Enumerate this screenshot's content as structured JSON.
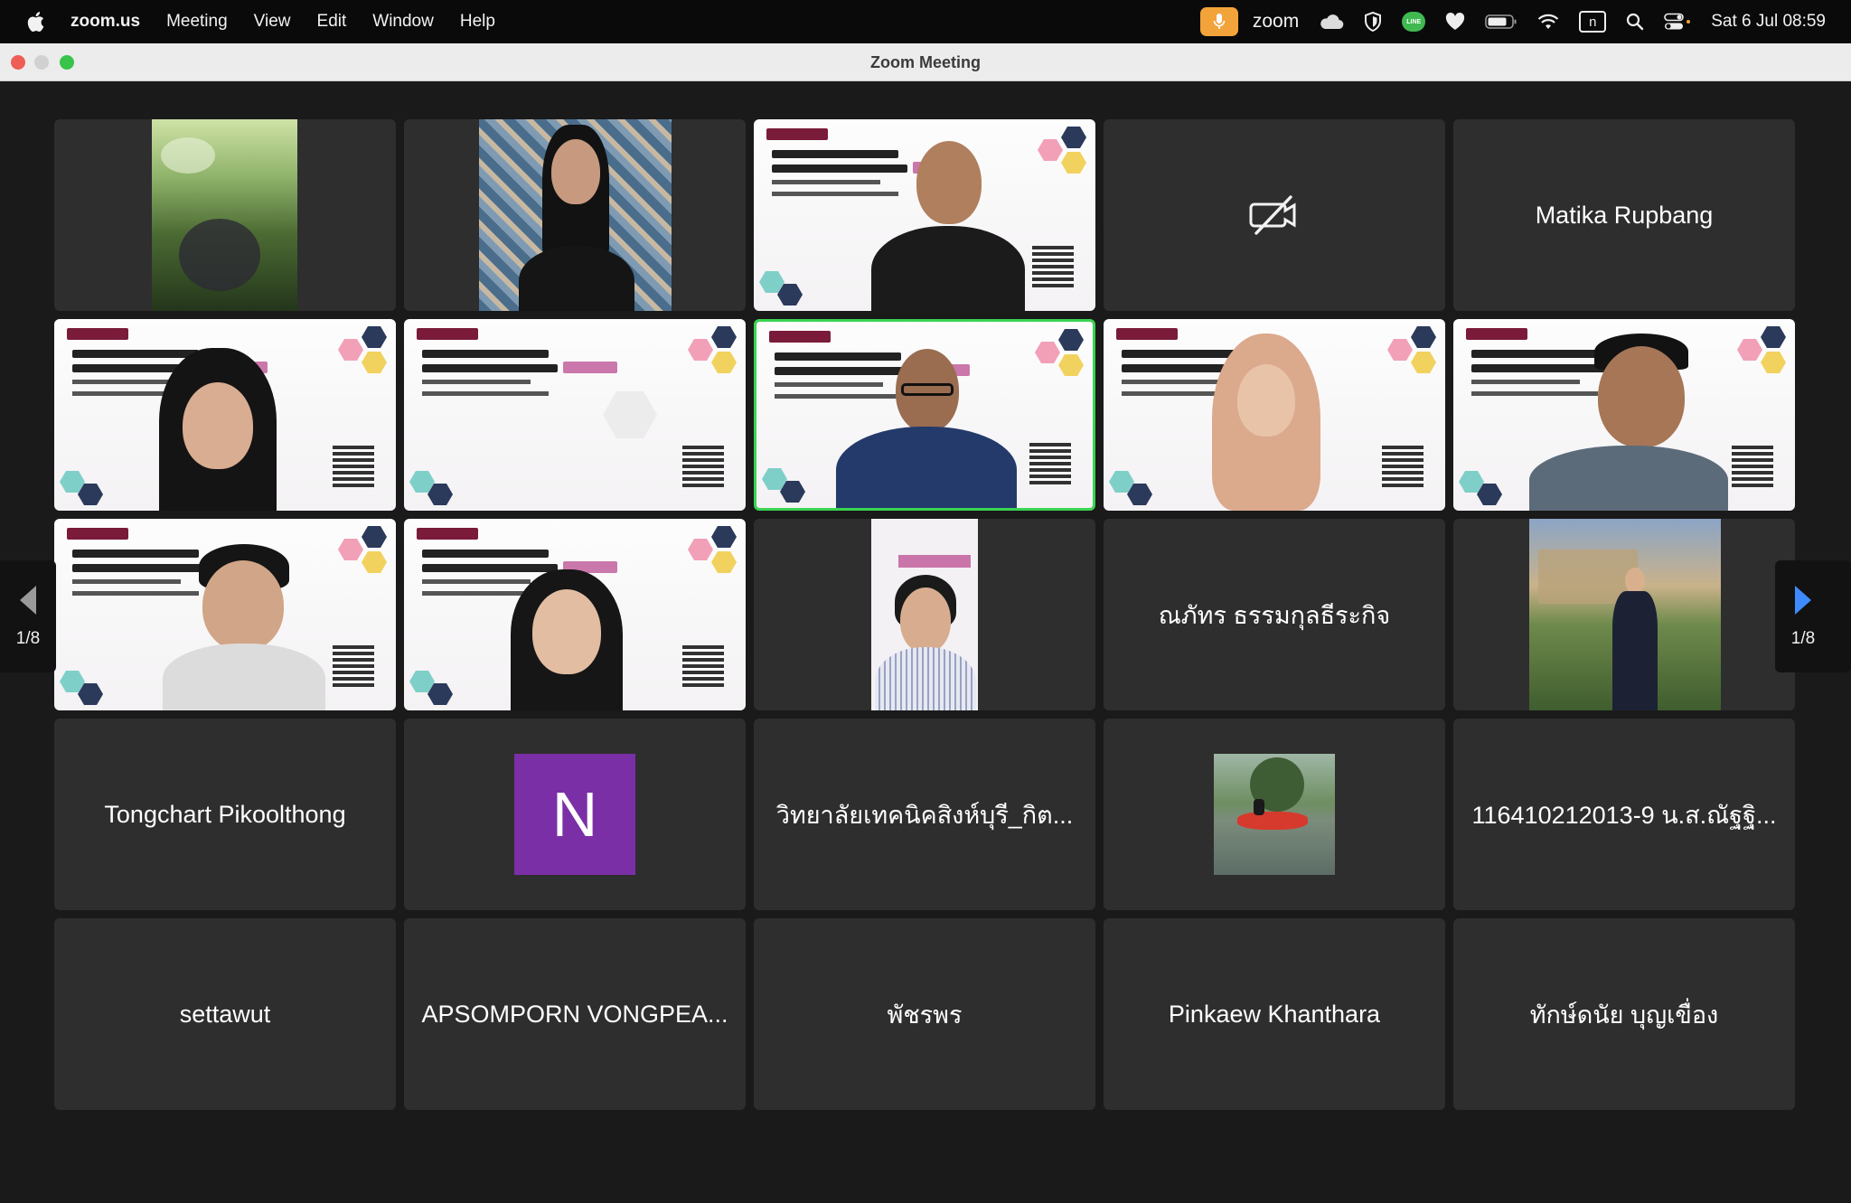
{
  "menubar": {
    "apple_icon": "apple-logo",
    "app_name": "zoom.us",
    "items": [
      "Meeting",
      "View",
      "Edit",
      "Window",
      "Help"
    ],
    "status": {
      "zoom_label": "zoom",
      "line_label": "LINE",
      "n_label": "n",
      "datetime": "Sat 6 Jul  08:59"
    },
    "colors": {
      "mic_pill": "#f2a33a",
      "line_badge": "#3fb950"
    }
  },
  "window": {
    "title": "Zoom Meeting"
  },
  "gallery": {
    "page_indicator_left": "1/8",
    "page_indicator_right": "1/8",
    "active_speaker_color": "#3ad452",
    "tiles": [
      {
        "kind": "video",
        "desc": "participant outdoors under trees"
      },
      {
        "kind": "video",
        "desc": "woman with floral background"
      },
      {
        "kind": "video",
        "desc": "man with event slide background"
      },
      {
        "kind": "camera-off"
      },
      {
        "kind": "name",
        "name": "Matika Rupbang"
      },
      {
        "kind": "video",
        "desc": "woman with slide background"
      },
      {
        "kind": "video",
        "desc": "slide background only"
      },
      {
        "kind": "video",
        "desc": "man with glasses, active speaker",
        "speaking": true
      },
      {
        "kind": "video",
        "desc": "woman in hijab with slide background"
      },
      {
        "kind": "video",
        "desc": "man with glasses with slide background"
      },
      {
        "kind": "video",
        "desc": "young man with slide background"
      },
      {
        "kind": "video",
        "desc": "woman with slide background"
      },
      {
        "kind": "video",
        "desc": "woman in portrait crop"
      },
      {
        "kind": "name",
        "name": "ณภัทร ธรรมกุลธีระกิจ"
      },
      {
        "kind": "video",
        "desc": "person standing outdoors in uniform"
      },
      {
        "kind": "name",
        "name": "Tongchart Pikoolthong"
      },
      {
        "kind": "avatar",
        "letter": "N",
        "color": "#7b2fa6"
      },
      {
        "kind": "name",
        "name": "วิทยาลัยเทคนิคสิงห์บุรี_กิต..."
      },
      {
        "kind": "thumb",
        "desc": "photo of red boat on water"
      },
      {
        "kind": "name",
        "name": "116410212013-9 น.ส.ณัฐฐิ..."
      },
      {
        "kind": "name",
        "name": "settawut"
      },
      {
        "kind": "name",
        "name": "APSOMPORN VONGPEA..."
      },
      {
        "kind": "name",
        "name": "พัชรพร"
      },
      {
        "kind": "name",
        "name": "Pinkaew Khanthara"
      },
      {
        "kind": "name",
        "name": "ทักษ์ดนัย บุญเขื่อง"
      }
    ]
  }
}
